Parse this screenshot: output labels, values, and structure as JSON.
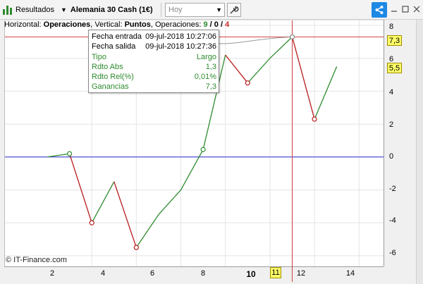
{
  "toolbar": {
    "results_label": "Resultados",
    "instrument_label": "Alemania 30 Cash (1€)",
    "period_value": "Hoy",
    "icons": [
      "bar-chart-icon",
      "dropdown-arrow-icon",
      "wrench-icon",
      "share-icon",
      "minimize-icon",
      "maximize-icon",
      "close-icon"
    ],
    "share_color": "#1e88e5"
  },
  "info": {
    "horizontal_label": "Horizontal:",
    "horizontal_value": "Operaciones",
    "vertical_label": ", Vertical:",
    "vertical_value": "Puntos",
    "ops_label": ", Operaciones:",
    "ops_total": "9",
    "ops_sep1": "/",
    "ops_neutral": "0",
    "ops_sep2": "/",
    "ops_losing": "4"
  },
  "tooltip": {
    "rows": [
      {
        "label": "Fecha entrada",
        "value": "09-jul-2018 10:27:06"
      },
      {
        "label": "Fecha salida",
        "value": "09-jul-2018 10:27:36"
      },
      {
        "label": "Tipo",
        "value": "Largo"
      },
      {
        "label": "Rdto Abs",
        "value": "1,3"
      },
      {
        "label": "Rdto Rel(%)",
        "value": "0,01%"
      },
      {
        "label": "Ganancias",
        "value": "7,3"
      }
    ]
  },
  "copyright": "© IT-Finance.com",
  "colors": {
    "gain": "#2e8b2e",
    "loss": "#b71c1c",
    "zero_line": "#2b2bd6",
    "crosshair": "#d04040",
    "badge": "#ffff66"
  },
  "chart_data": {
    "type": "line",
    "x": [
      0,
      1,
      2,
      3,
      4,
      5,
      6,
      7,
      8,
      9,
      10,
      11,
      12,
      13
    ],
    "values": [
      0,
      0.2,
      -4,
      -1.5,
      -5.5,
      -3.5,
      -2,
      0.45,
      6.2,
      4.5,
      6,
      7.3,
      2.3,
      5.5
    ],
    "xlim": [
      -1.9,
      15.1
    ],
    "ylim": [
      -6.65,
      8.3
    ],
    "x_ticks": [
      "2",
      "4",
      "6",
      "8",
      "10",
      "12",
      "14"
    ],
    "y_ticks": [
      "8",
      "6",
      "4",
      "2",
      "0",
      "-2",
      "-4",
      "-6"
    ],
    "x_cursor_label": "11",
    "y_cursor_label": "7,3",
    "y_last_label": "5,5",
    "grid": true
  }
}
